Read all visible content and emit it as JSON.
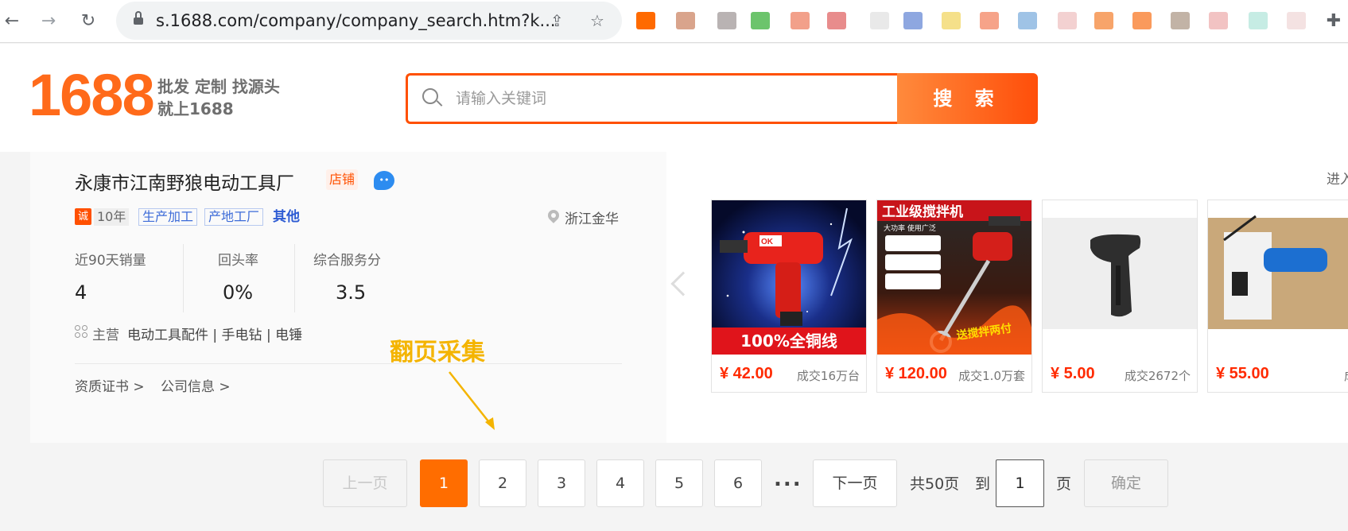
{
  "browser": {
    "url": "s.1688.com/company/company_search.htm?k...",
    "back_icon": "←",
    "forward_icon": "→",
    "reload_icon": "↻",
    "share_icon": "⇪",
    "star_icon": "☆",
    "puzzle_icon": "✚"
  },
  "header": {
    "logo": "1688",
    "slogan_line1": "批发 定制 找源头",
    "slogan_line2": "就上1688",
    "search_placeholder": "请输入关键词",
    "search_button": "搜 索"
  },
  "company": {
    "name": "永康市江南野狼电动工具厂",
    "shop_tag": "店铺",
    "cheng_badge": "诚",
    "years": "10年",
    "tags": [
      "生产加工",
      "产地工厂"
    ],
    "other": "其他",
    "location": "浙江金华",
    "stats": [
      {
        "label": "近90天销量",
        "value": "4"
      },
      {
        "label": "回头率",
        "value": "0%"
      },
      {
        "label": "综合服务分",
        "value": "3.5"
      }
    ],
    "main_label": "主营",
    "main_items": "电动工具配件 | 手电钻 | 电锤",
    "links": [
      "资质证书 >",
      "公司信息 >"
    ]
  },
  "products": {
    "enter_shop": "进入",
    "items": [
      {
        "price": "¥ 42.00",
        "sold": "成交16万台",
        "banner": "100%全铜线",
        "brand": "OK"
      },
      {
        "price": "¥ 120.00",
        "sold": "成交1.0万套",
        "banner": "工业级搅拌机",
        "sub": "大功率 使用广泛",
        "foot": "送搅拌两付"
      },
      {
        "price": "¥ 5.00",
        "sold": "成交2672个"
      },
      {
        "price": "¥ 55.00",
        "sold": "成"
      }
    ]
  },
  "annotation": "翻页采集",
  "pagination": {
    "prev": "上一页",
    "pages": [
      "1",
      "2",
      "3",
      "4",
      "5",
      "6"
    ],
    "active_page": "1",
    "dots": "...",
    "next": "下一页",
    "total": "共50页",
    "goto_label": "到",
    "goto_value": "1",
    "page_unit": "页",
    "confirm": "确定"
  },
  "colors": {
    "brand": "#ff6a1a",
    "search_border": "#ff5000",
    "active_page": "#ff6d00",
    "price": "#ff2a00",
    "annotation": "#f4b400"
  }
}
